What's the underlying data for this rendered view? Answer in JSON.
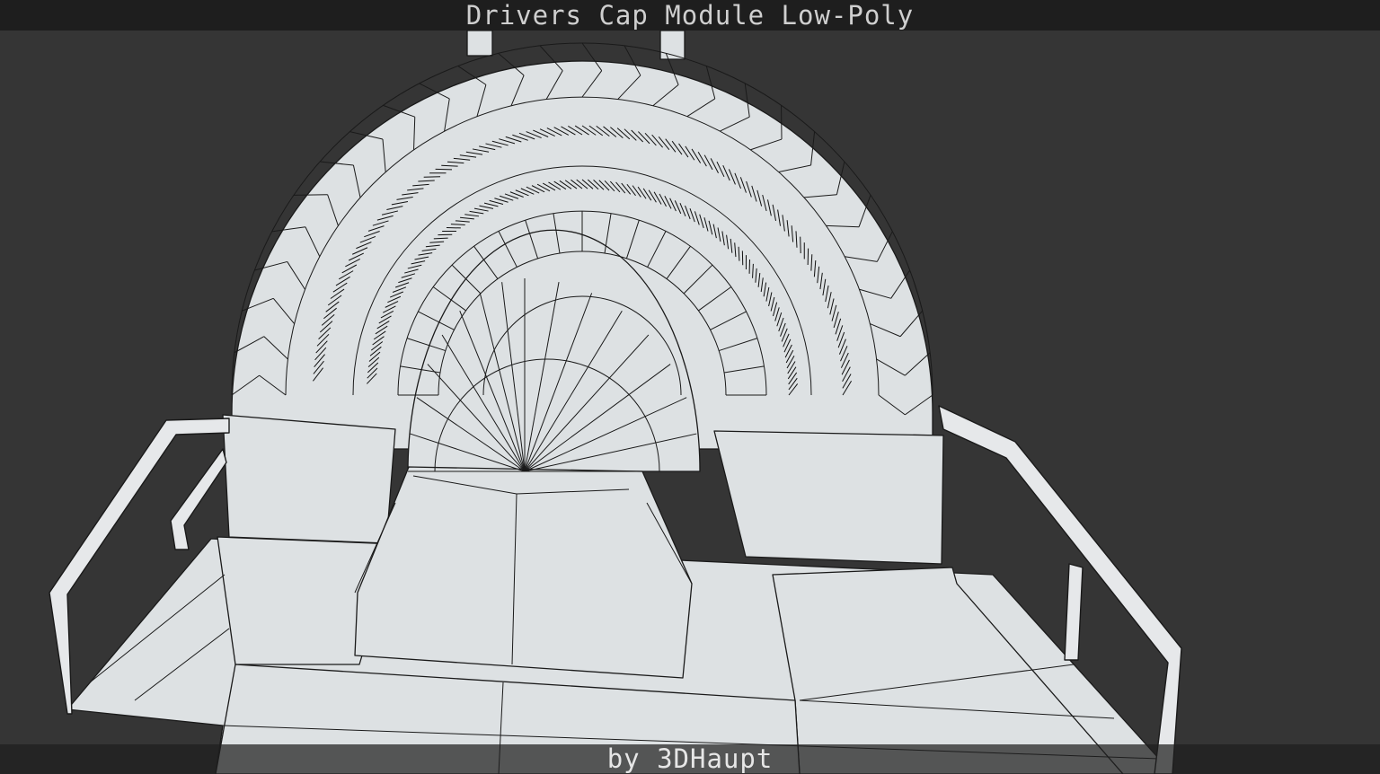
{
  "title": "Drivers Cap Module Low-Poly",
  "credit": "by 3DHaupt",
  "colors": {
    "background": "#353535",
    "mesh_fill": "#dde1e3",
    "wire": "#1a1a1a",
    "bar": "#1e1e1e"
  }
}
